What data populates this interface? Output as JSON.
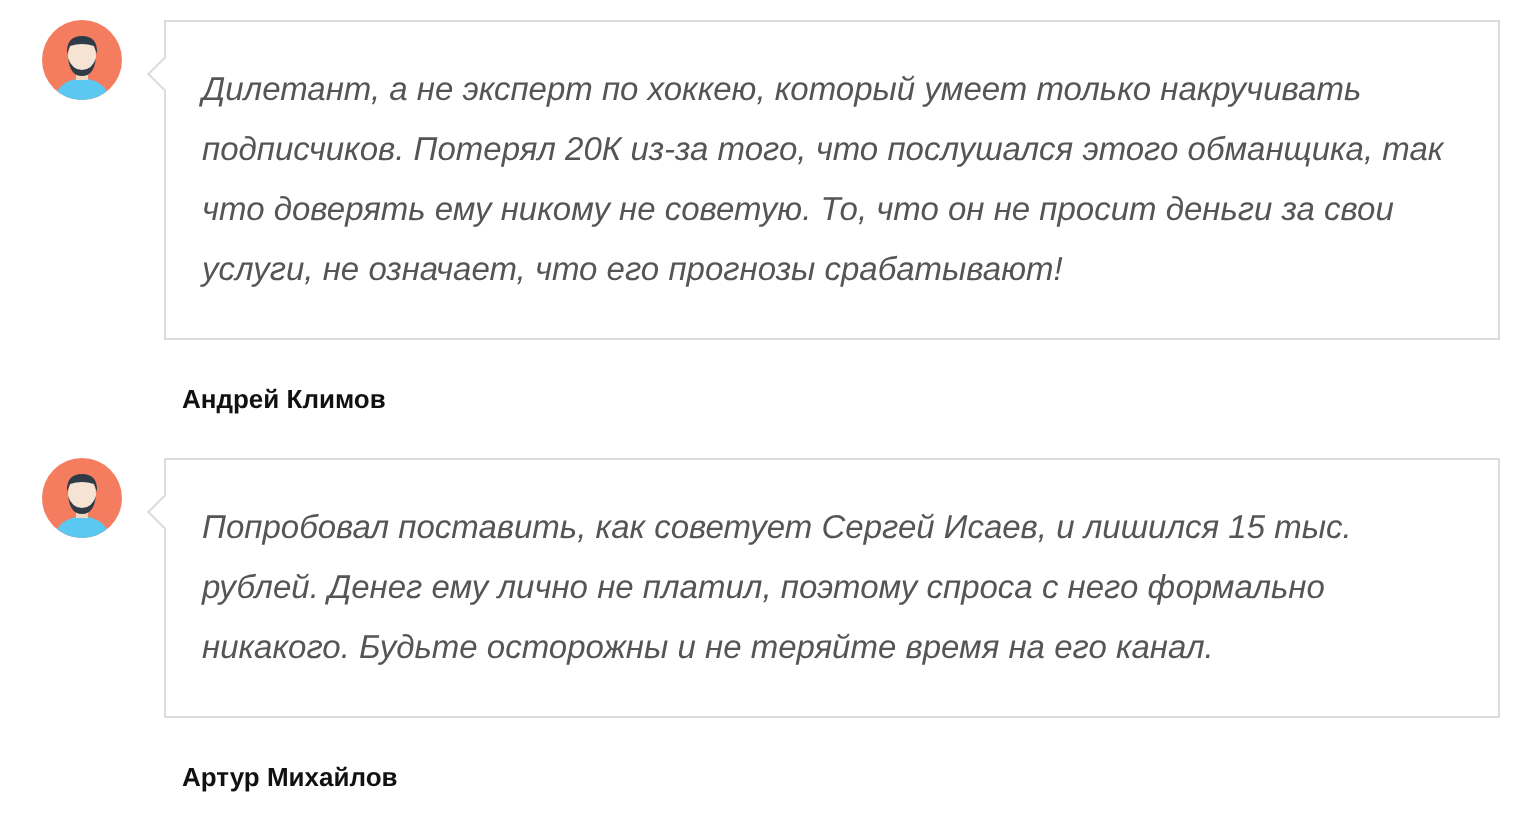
{
  "comments": [
    {
      "text": "Дилетант, а не эксперт по хоккею, который умеет только накручивать подписчиков. Потерял 20К из-за того, что послушался этого обманщика, так что доверять ему никому не советую. То, что он не просит деньги за свои услуги, не означает, что его прогнозы срабатывают!",
      "author": "Андрей Климов"
    },
    {
      "text": "Попробовал поставить, как советует Сергей Исаев, и лишился 15 тыс. рублей. Денег ему лично не платил, поэтому спроса с него формально никакого. Будьте осторожны и не теряйте время на его канал.",
      "author": "Артур Михайлов"
    }
  ]
}
